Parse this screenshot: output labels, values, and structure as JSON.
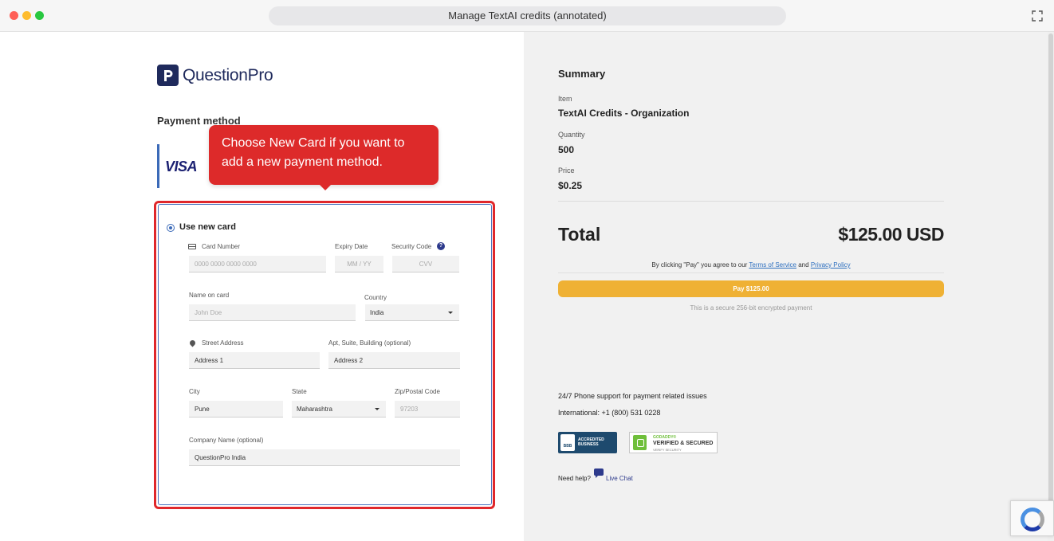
{
  "window": {
    "title": "Manage TextAI credits (annotated)"
  },
  "brand": {
    "logo_text": "QuestionPro",
    "color": "#1f2a5c"
  },
  "payment": {
    "heading": "Payment method",
    "saved_card_brand": "VISA",
    "tooltip": "Choose New Card if you want to add a new payment method.",
    "use_new_card_label": "Use new card",
    "fields": {
      "card_number": {
        "label": "Card Number",
        "placeholder": "0000 0000 0000 0000"
      },
      "expiry": {
        "label": "Expiry Date",
        "placeholder": "MM / YY"
      },
      "security": {
        "label": "Security Code",
        "placeholder": "CVV"
      },
      "name": {
        "label": "Name on card",
        "placeholder": "John Doe"
      },
      "country": {
        "label": "Country",
        "value": "India"
      },
      "street": {
        "label": "Street Address",
        "value": "Address 1"
      },
      "apt": {
        "label": "Apt, Suite, Building (optional)",
        "value": "Address 2"
      },
      "city": {
        "label": "City",
        "value": "Pune"
      },
      "state": {
        "label": "State",
        "value": "Maharashtra"
      },
      "zip": {
        "label": "Zip/Postal Code",
        "placeholder": "97203"
      },
      "company": {
        "label": "Company Name (optional)",
        "value": "QuestionPro India"
      }
    },
    "highlight_color": "#e0272b"
  },
  "summary": {
    "heading": "Summary",
    "item_label": "Item",
    "item_value": "TextAI Credits - Organization",
    "quantity_label": "Quantity",
    "quantity_value": "500",
    "price_label": "Price",
    "price_value": "$0.25",
    "total_label": "Total",
    "total_value": "$125.00 USD",
    "agree_prefix": "By clicking \"Pay\" you agree to our",
    "terms_link": "Terms of Service",
    "and": "and",
    "privacy_link": "Privacy Policy",
    "pay_button": "Pay $125.00",
    "pay_color": "#efb134",
    "secure_note": "This is a secure 256-bit encrypted payment",
    "support_line": "24/7 Phone support for payment related issues",
    "phone_line": "International: +1 (800) 531 0228",
    "need_help": "Need help?",
    "live_chat": "Live Chat"
  },
  "badges": {
    "bbb_logo": "BBB",
    "bbb_line1": "ACCREDITED",
    "bbb_line2": "BUSINESS",
    "godaddy_brand": "GODADDY®",
    "godaddy_line": "VERIFIED & SECURED",
    "godaddy_sub": "VERIFY SECURITY"
  }
}
